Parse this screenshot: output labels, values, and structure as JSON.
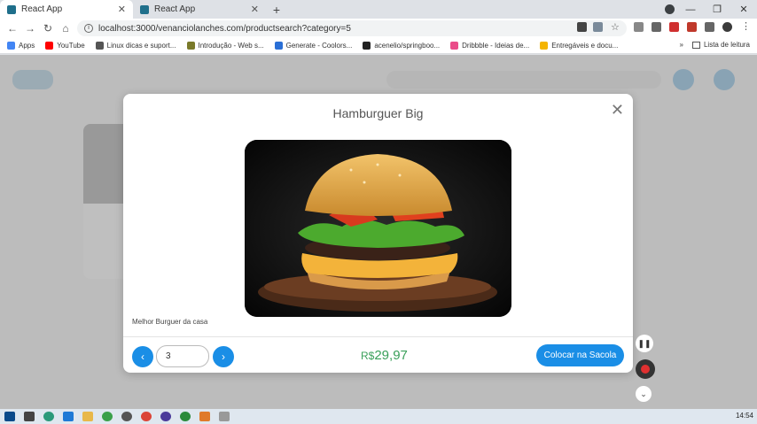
{
  "browser": {
    "tabs": [
      {
        "title": "React App",
        "active": true
      },
      {
        "title": "React App",
        "active": false
      }
    ],
    "url": "localhost:3000/venanciolanches.com/productsearch?category=5",
    "bookmarks": [
      {
        "label": "Apps",
        "color": "#4285f4"
      },
      {
        "label": "YouTube",
        "color": "#ff0000"
      },
      {
        "label": "Linux dicas e suport...",
        "color": "#555555"
      },
      {
        "label": "Introdução - Web s...",
        "color": "#7a7a2a"
      },
      {
        "label": "Generate - Coolors...",
        "color": "#2a6fd6"
      },
      {
        "label": "acenelio/springboo...",
        "color": "#222222"
      },
      {
        "label": "Dribbble - Ideias de...",
        "color": "#ea4c89"
      },
      {
        "label": "Entregáveis e docu...",
        "color": "#f4b400"
      }
    ],
    "reading_list": "Lista de leitura",
    "more": "»"
  },
  "modal": {
    "title": "Hamburguer Big",
    "description": "Melhor Burguer da casa",
    "quantity": "3",
    "price_currency": "R$",
    "price_value": "29,97",
    "add_button": "Colocar na Sacola",
    "accent_color": "#1a8ee6",
    "price_color": "#3aa05a"
  },
  "taskbar": {
    "clock": "14:54"
  }
}
